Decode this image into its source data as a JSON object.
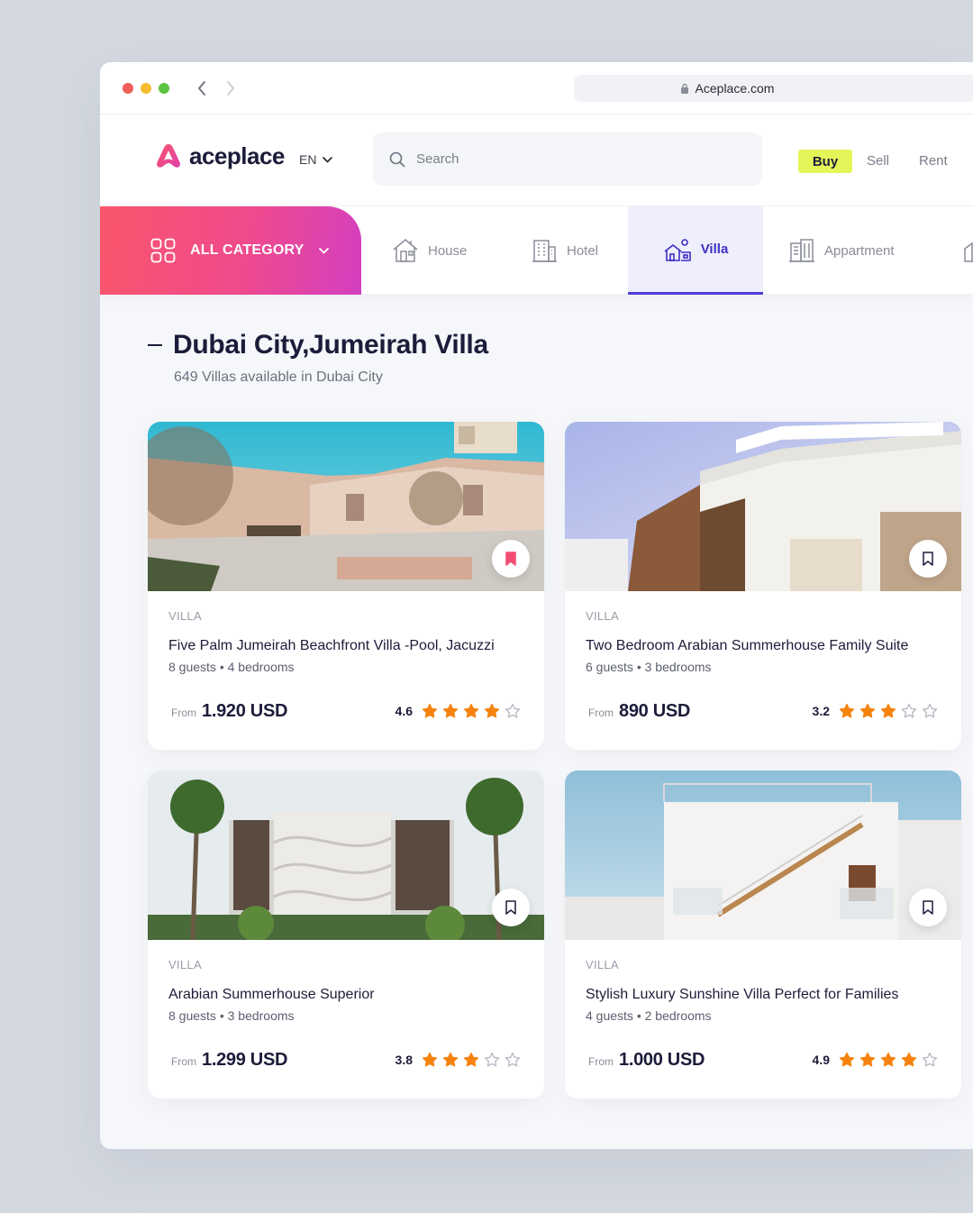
{
  "browser": {
    "url": "Aceplace.com"
  },
  "header": {
    "logo_text": "aceplace",
    "language": "EN",
    "search_placeholder": "Search",
    "modes": {
      "buy": "Buy",
      "sell": "Sell",
      "rent": "Rent"
    },
    "colors": {
      "accent_buy": "#e4f55a"
    }
  },
  "categories": {
    "all_label": "ALL CATEGORY",
    "items": [
      {
        "label": "House",
        "icon": "house-icon"
      },
      {
        "label": "Hotel",
        "icon": "hotel-icon"
      },
      {
        "label": "Villa",
        "icon": "villa-icon",
        "active": true
      },
      {
        "label": "Appartment",
        "icon": "apartment-icon"
      }
    ],
    "colors": {
      "gradient_start": "#f9566b",
      "gradient_end": "#d43fc1",
      "active": "#3b2fc4"
    }
  },
  "main": {
    "title": "Dubai City,Jumeirah Villa",
    "subtitle": "649 Villas available in Dubai City"
  },
  "listings": [
    {
      "type": "VILLA",
      "name": "Five Palm Jumeirah Beachfront Villa -Pool, Jacuzzi",
      "meta": "8 guests • 4 bedrooms",
      "from": "From",
      "price": "1.920 USD",
      "rating": "4.6",
      "stars": 4,
      "saved": true
    },
    {
      "type": "VILLA",
      "name": "Two Bedroom Arabian Summerhouse Family Suite",
      "meta": "6 guests • 3 bedrooms",
      "from": "From",
      "price": "890 USD",
      "rating": "3.2",
      "stars": 3,
      "saved": false
    },
    {
      "type": "VILLA",
      "name": "Arabian Summerhouse Superior",
      "meta": "8 guests • 3 bedrooms",
      "from": "From",
      "price": "1.299 USD",
      "rating": "3.8",
      "stars": 3,
      "saved": false
    },
    {
      "type": "VILLA",
      "name": "Stylish Luxury Sunshine Villa Perfect for Families",
      "meta": "4 guests • 2 bedrooms",
      "from": "From",
      "price": "1.000 USD",
      "rating": "4.9",
      "stars": 4,
      "saved": false
    }
  ],
  "colors": {
    "star": "#f5830e",
    "saved_bookmark": "#f14d72"
  }
}
